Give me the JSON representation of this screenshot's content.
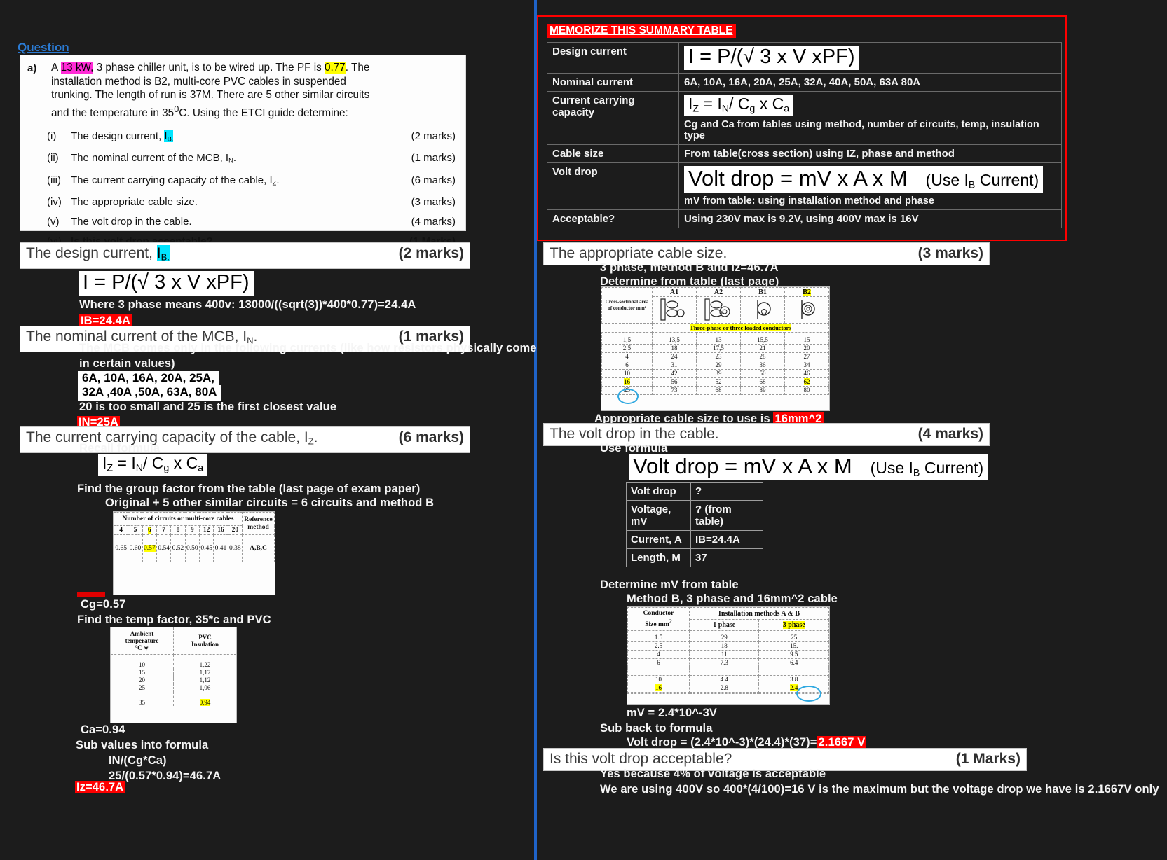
{
  "question": {
    "label": "Question",
    "part": "a)",
    "paragraph_pre": "A ",
    "kw": "13 kW,",
    "paragraph_mid": " 3 phase chiller unit, is to be wired up. The PF is ",
    "pf": "0.77",
    "paragraph_post": ". The installation method is B2, multi-core PVC cables in suspended trunking. The length of run is 37M. There are 5 other similar circuits and the temperature in 35",
    "paragraph_post2": "C. Using the ETCI guide determine:",
    "degree": "0",
    "items": [
      {
        "n": "(i)",
        "text_pre": "The design current, ",
        "text_hl": "I",
        "text_hl_sub": "B.",
        "marks": "(2 marks)"
      },
      {
        "n": "(ii)",
        "text": "The nominal current of the MCB, I",
        "sub": "N",
        "tail": ".",
        "marks": "(1 marks)"
      },
      {
        "n": "(iii)",
        "text": "The current carrying capacity of the cable, I",
        "sub": "Z",
        "tail": ".",
        "marks": "(6 marks)"
      },
      {
        "n": "(iv)",
        "text": "The appropriate cable size.",
        "sub": "",
        "tail": "",
        "marks": "(3 marks)"
      },
      {
        "n": "(v)",
        "text": "The volt drop in the cable.",
        "sub": "",
        "tail": "",
        "marks": "(4 marks)"
      },
      {
        "n": "(vi)",
        "text": "Is this volt drop acceptable?",
        "sub": "",
        "tail": "",
        "marks": "(1 Marks)"
      }
    ]
  },
  "summary": {
    "title": "MEMORIZE THIS SUMMARY TABLE",
    "rows": [
      {
        "key": "Design current",
        "formula": "I = P/(√ 3 x V xPF)",
        "note": ""
      },
      {
        "key": "Nominal current",
        "value": "6A, 10A, 16A, 20A, 25A, 32A, 40A, 50A, 63A 80A"
      },
      {
        "key": "Current carrying capacity",
        "formula": "IZ = IN / Cg x Ca",
        "note": "Cg and Ca from tables using method, number of circuits, temp, insulation type"
      },
      {
        "key": "Cable size",
        "value": "From table(cross section) using IZ, phase and method"
      },
      {
        "key": "Volt drop",
        "formula": "Volt drop = mV x A x M",
        "formula_tail": "(Use IB Current)",
        "note": "mV from  table: using installation method and phase"
      },
      {
        "key": "Acceptable?",
        "value": "Using 230V max is 9.2V, using 400V max is 16V"
      }
    ]
  },
  "left": {
    "sec1": {
      "title_pre": "The design current, ",
      "title_hl": "I",
      "title_hl_sub": "B.",
      "marks": "(2 marks)"
    },
    "sec1_formula": "I = P/(√ 3 x V xPF)",
    "sec1_line1": "Where 3 phase means 400v:  13000/((sqrt(3))*400*0.77)=24.4A",
    "sec1_answer": "IB=24.4A",
    "sec2": {
      "title": "The nominal current of the MCB, I",
      "title_sub": "N",
      "title_tail": ".",
      "marks": "(1 marks)"
    },
    "sec2_line1": "The MCB comes only in the following currents (like how resistors physically come",
    "sec2_line2": "in certain values)",
    "sec2_box1": "6A, 10A, 16A, 20A, 25A,",
    "sec2_box2": "32A ,40A ,50A, 63A, 80A",
    "sec2_line3": "20 is too small and 25 is the first closest value",
    "sec2_answer": "IN=25A",
    "sec3": {
      "title": "The current carrying capacity of the cable, I",
      "title_sub": "Z",
      "title_tail": ".",
      "marks": "(6 marks)"
    },
    "sec3_line1": "Recall formula",
    "sec3_formula": "IZ = IN / Cg x Ca",
    "sec3_line2": "Find the group factor from the table (last page of exam paper)",
    "sec3_line3": "Original + 5 other similar circuits = 6 circuits and method B",
    "sec3_cg": "Cg=0.57",
    "sec3_line4": "Find the temp factor, 35*c and PVC",
    "sec3_ca": "Ca=0.94",
    "sec3_line5": "Sub values into formula",
    "sec3_line6": "IN/(Cg*Ca)",
    "sec3_line7": "25/(0.57*0.94)=46.7A",
    "sec3_answer": "Iz=46.7A"
  },
  "right": {
    "sec4": {
      "title": "The appropriate cable size.",
      "marks": "(3 marks)"
    },
    "sec4_line1": "3 phase, method B and Iz=46.7A",
    "sec4_line2": "Determine from table (last page)",
    "sec4_result_pre": "Appropriate cable size to use is ",
    "sec4_result_hl": "16mm^2",
    "sec5": {
      "title": "The volt drop in the cable.",
      "marks": "(4 marks)"
    },
    "sec5_line1": "Use formula",
    "sec5_formula": "Volt drop = mV x A x M",
    "sec5_formula_tail": "(Use IB Current)",
    "sec5_table": [
      {
        "k": "Volt drop",
        "v": "?"
      },
      {
        "k": "Voltage, mV",
        "v": "? (from table)"
      },
      {
        "k": "Current, A",
        "v": "IB=24.4A"
      },
      {
        "k": "Length, M",
        "v": "37"
      }
    ],
    "sec5_line2": "Determine mV from table",
    "sec5_line3": "Method B, 3 phase and 16mm^2 cable",
    "sec5_line4": "mV = 2.4*10^-3V",
    "sec5_line5": "Sub back to formula",
    "sec5_line6_pre": "Volt drop = (2.4*10^-3)*(24.4)*(37)=",
    "sec5_line6_hl": "2.1667 V",
    "sec6": {
      "title": "Is this volt drop acceptable?",
      "marks": "(1 Marks)"
    },
    "sec6_line1": "Yes because 4% of voltage is acceptable",
    "sec6_line2": "We are using 400V so 400*(4/100)=16 V is the maximum but the voltage drop we have is 2.1667V only"
  },
  "tables": {
    "cg": {
      "header": "Number of circuits or multi-core cables",
      "ref_header": "Reference method",
      "cols": [
        "4",
        "5",
        "6",
        "7",
        "8",
        "9",
        "12",
        "16",
        "20"
      ],
      "vals": [
        "0.65",
        "0.60",
        "0.57",
        "0.54",
        "0.52",
        "0.50",
        "0.45",
        "0.41",
        "0.38"
      ],
      "ref": "A,B,C",
      "highlight_col": "6",
      "highlight_val": "0.57"
    },
    "ca": {
      "col1": "Ambient temperature °C ∗",
      "col2": "PVC Insulation",
      "rows": [
        {
          "t": "10",
          "v": "1,22"
        },
        {
          "t": "15",
          "v": "1,17"
        },
        {
          "t": "20",
          "v": "1,12"
        },
        {
          "t": "25",
          "v": "1,06"
        },
        {
          "t": "35",
          "v": "0,94"
        }
      ],
      "highlight_val": "0,94"
    },
    "cable_size": {
      "corner": "Cross-sectional area of conductor mm²",
      "methods": [
        "A1",
        "A2",
        "B1",
        "B2"
      ],
      "span_note": "Three-phase or three loaded conductors",
      "rows": [
        {
          "csa": "1,5",
          "A1": "13,5",
          "A2": "13",
          "B1": "15,5",
          "B2": "15"
        },
        {
          "csa": "2,5",
          "A1": "18",
          "A2": "17,5",
          "B1": "21",
          "B2": "20"
        },
        {
          "csa": "4",
          "A1": "24",
          "A2": "23",
          "B1": "28",
          "B2": "27"
        },
        {
          "csa": "6",
          "A1": "31",
          "A2": "29",
          "B1": "36",
          "B2": "34"
        },
        {
          "csa": "10",
          "A1": "42",
          "A2": "39",
          "B1": "50",
          "B2": "46"
        },
        {
          "csa": "16",
          "A1": "56",
          "A2": "52",
          "B1": "68",
          "B2": "62"
        },
        {
          "csa": "25",
          "A1": "73",
          "A2": "68",
          "B1": "89",
          "B2": "80"
        }
      ],
      "highlight_method": "B2",
      "circled_csa": "16",
      "highlight_value": "62"
    },
    "mv": {
      "corner": "Conductor Size mm²",
      "group_header": "Installation methods A & B",
      "sub_headers": [
        "1 phase",
        "3 phase"
      ],
      "rows": [
        {
          "size": "1.5",
          "p1": "29",
          "p3": "25"
        },
        {
          "size": "2.5",
          "p1": "18",
          "p3": "15."
        },
        {
          "size": "4",
          "p1": "11",
          "p3": "9.5"
        },
        {
          "size": "6",
          "p1": "7.3",
          "p3": "6.4"
        },
        {
          "size": "",
          "p1": "",
          "p3": ""
        },
        {
          "size": "10",
          "p1": "4.4",
          "p3": "3.8"
        },
        {
          "size": "16",
          "p1": "2.8",
          "p3": "2.4"
        },
        {
          "size": "",
          "p1": "",
          "p3": ""
        }
      ],
      "highlight_size": "16",
      "highlight_subheader": "3 phase",
      "circled_value": "2.4"
    }
  },
  "colors": {
    "background": "#1c1c1c",
    "divider": "#1f63c8",
    "accent_red": "#ff0000",
    "highlight_yellow": "#ffff00",
    "highlight_cyan": "#00e5ff",
    "highlight_pink": "#ff2bd6",
    "link_blue": "#2b7bd4"
  }
}
